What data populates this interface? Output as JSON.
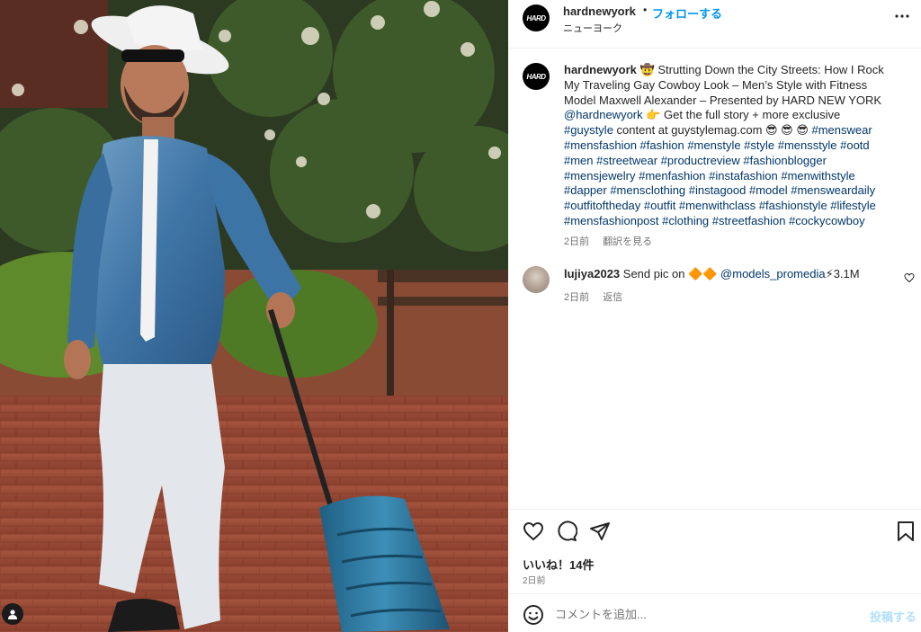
{
  "post": {
    "username": "hardnewyork",
    "avatar_text": "HARD",
    "follow_label": "フォローする",
    "dot": "•",
    "location": "ニューヨーク",
    "more_icon": "more-horizontal-icon"
  },
  "caption": {
    "username": "hardnewyork",
    "lines": [
      {
        "parts": [
          {
            "t": "🤠 Strutting Down the City Streets: How I Rock",
            "tag": false
          }
        ]
      },
      {
        "parts": [
          {
            "t": "My Traveling Gay Cowboy Look – Men’s Style with Fitness",
            "tag": false
          }
        ]
      },
      {
        "parts": [
          {
            "t": "Model Maxwell Alexander – Presented by HARD NEW YORK",
            "tag": false
          }
        ]
      },
      {
        "parts": [
          {
            "t": "@hardnewyork",
            "tag": true
          },
          {
            "t": " 👉 Get the full story + more exclusive",
            "tag": false
          }
        ]
      },
      {
        "parts": [
          {
            "t": "#guystyle",
            "tag": true
          },
          {
            "t": " content at guystylemag.com 😎 😎 😎 ",
            "tag": false
          },
          {
            "t": "#menswear",
            "tag": true
          }
        ]
      },
      {
        "parts": [
          {
            "t": "#mensfashion #fashion #menstyle #style #mensstyle #ootd",
            "tag": true
          }
        ]
      },
      {
        "parts": [
          {
            "t": "#men #streetwear #productreview #fashionblogger",
            "tag": true
          }
        ]
      },
      {
        "parts": [
          {
            "t": "#mensjewelry #menfashion #instafashion #menwithstyle",
            "tag": true
          }
        ]
      },
      {
        "parts": [
          {
            "t": "#dapper #mensclothing #instagood #model #mensweardaily",
            "tag": true
          }
        ]
      },
      {
        "parts": [
          {
            "t": "#outfitoftheday #outfit #menwithclass #fashionstyle #lifestyle",
            "tag": true
          }
        ]
      },
      {
        "parts": [
          {
            "t": "#mensfashionpost #clothing #streetfashion #cockycowboy",
            "tag": true
          }
        ]
      }
    ],
    "time": "2日前",
    "translate": "翻訳を見る"
  },
  "comment": {
    "username": "lujiya2023",
    "text_before": "Send pic on 🔶🔶 ",
    "mention": "@models_promedia",
    "text_after": "⚡3.1M",
    "time": "2日前",
    "reply": "返信"
  },
  "actions": {
    "likes": "いいね！14件",
    "when": "2日前"
  },
  "add_comment": {
    "placeholder": "コメントを追加...",
    "post_label": "投稿する"
  },
  "colors": {
    "link": "#0095f6",
    "hashtag": "#00376b",
    "muted": "#737373",
    "post_disabled": "#b2dffc"
  }
}
